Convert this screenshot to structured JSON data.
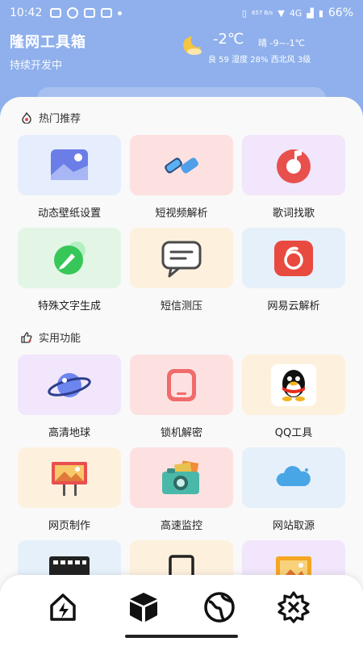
{
  "status_bar": {
    "time": "10:42",
    "network": "4G",
    "speed": "657 B/s",
    "battery": "66%"
  },
  "header": {
    "title": "隆网工具箱",
    "subtitle": "持续开发中"
  },
  "weather": {
    "icon": "moon-cloud-icon",
    "temperature": "-2℃",
    "condition": "晴 -9~-1℃",
    "details": "良 59 湿度 28% 西北风 3级"
  },
  "sections": {
    "hot": {
      "title": "热门推荐",
      "icon": "fire-icon"
    },
    "useful": {
      "title": "实用功能",
      "icon": "thumbs-up-icon"
    }
  },
  "hot_items": [
    {
      "label": "动态壁纸设置",
      "icon": "wallpaper-icon"
    },
    {
      "label": "短视频解析",
      "icon": "link-icon"
    },
    {
      "label": "歌词找歌",
      "icon": "music-icon"
    },
    {
      "label": "特殊文字生成",
      "icon": "pen-icon"
    },
    {
      "label": "短信测压",
      "icon": "message-icon"
    },
    {
      "label": "网易云解析",
      "icon": "netease-icon"
    }
  ],
  "useful_items": [
    {
      "label": "高清地球",
      "icon": "planet-icon"
    },
    {
      "label": "锁机解密",
      "icon": "phone-lock-icon"
    },
    {
      "label": "QQ工具",
      "icon": "qq-penguin-icon"
    },
    {
      "label": "网页制作",
      "icon": "billboard-icon"
    },
    {
      "label": "高速监控",
      "icon": "camera-icon"
    },
    {
      "label": "网站取源",
      "icon": "cloud-icon"
    }
  ],
  "bottom_nav": [
    {
      "icon": "home-bolt-icon"
    },
    {
      "icon": "cube-icon"
    },
    {
      "icon": "globe-icon"
    },
    {
      "icon": "settings-icon"
    }
  ]
}
